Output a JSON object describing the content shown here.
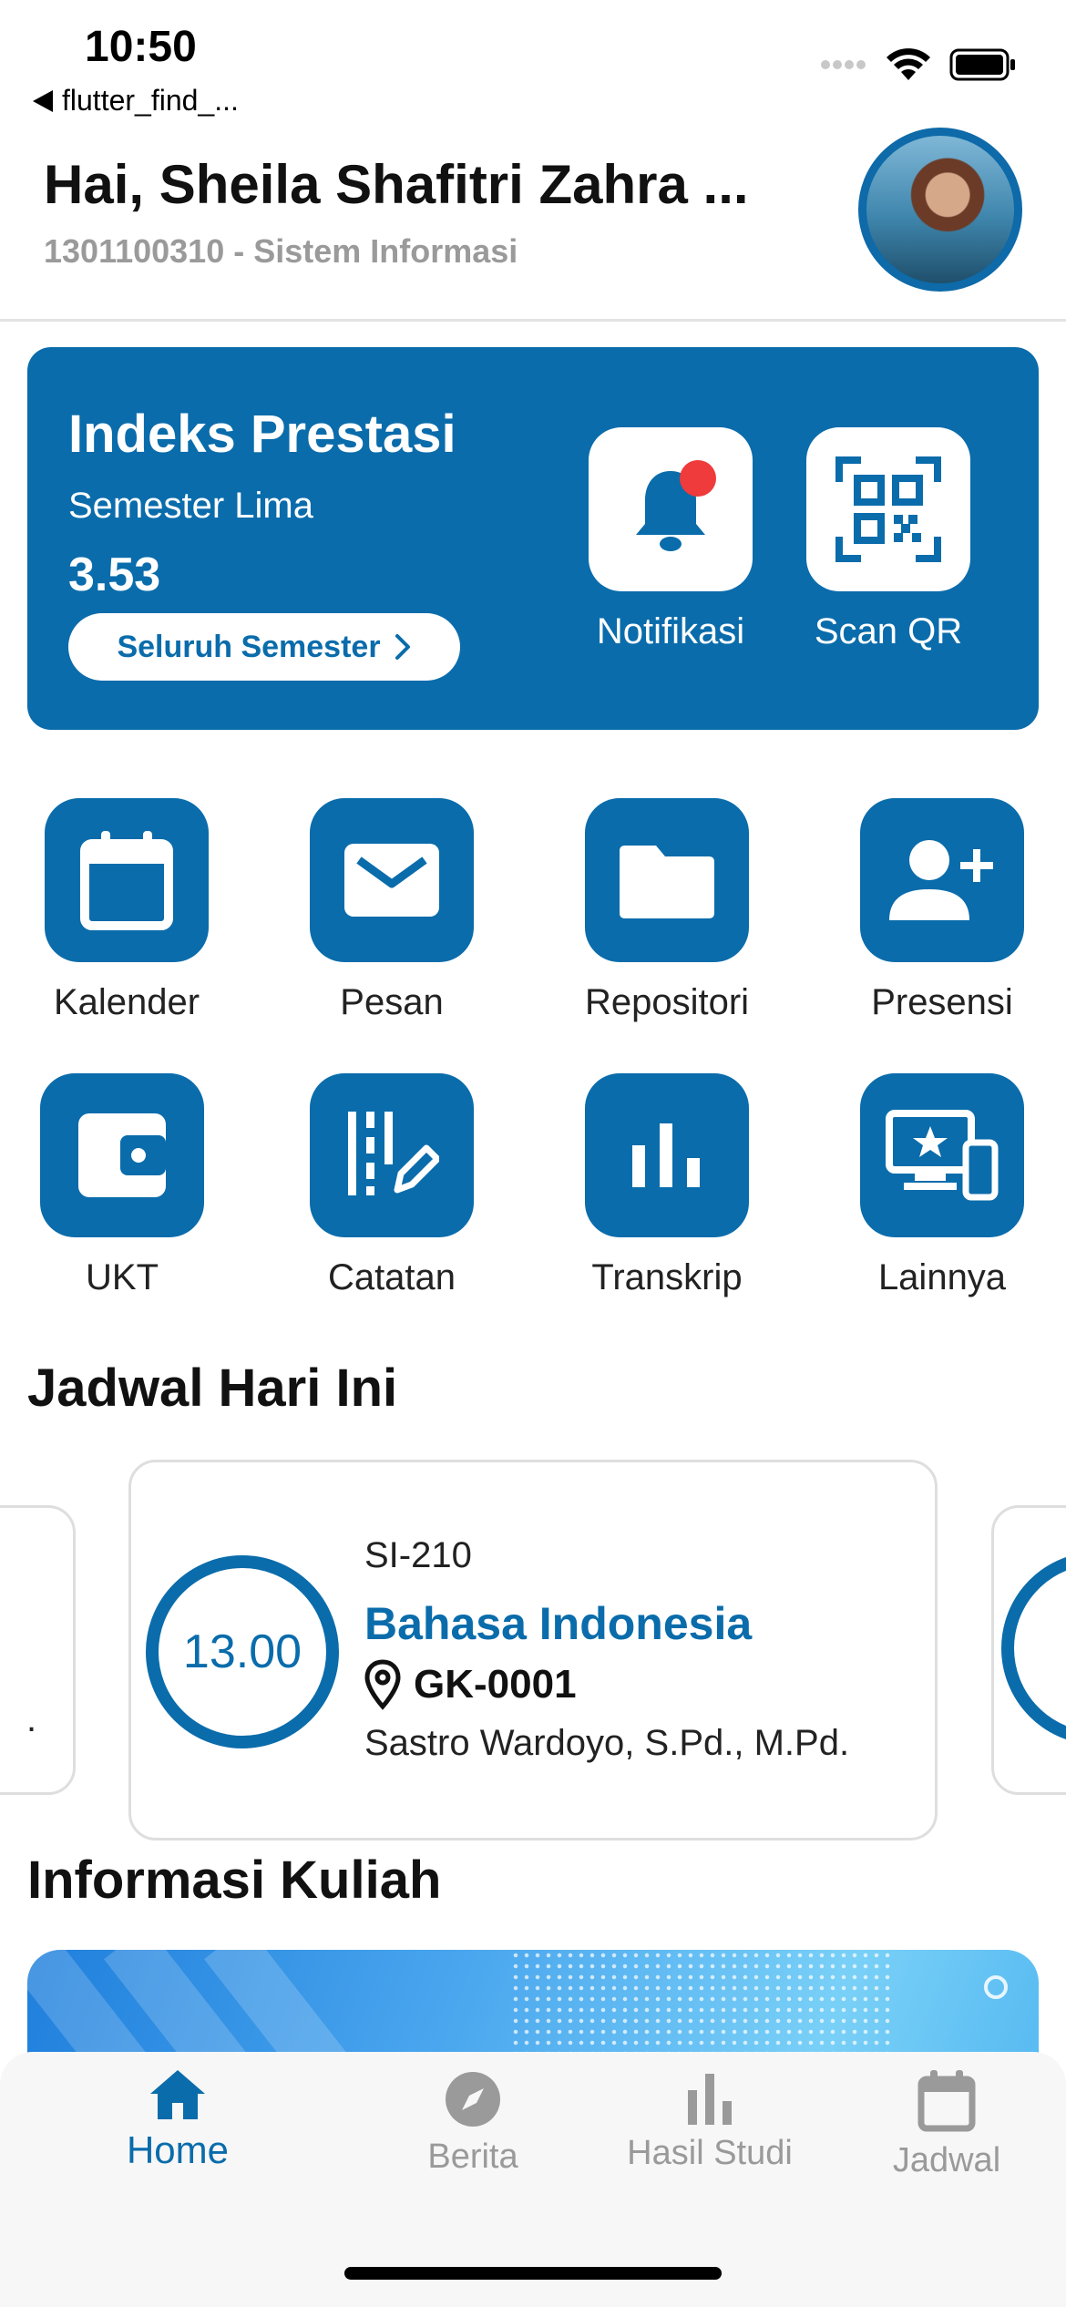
{
  "status_bar": {
    "time": "10:50",
    "back_app": "flutter_find_..."
  },
  "header": {
    "greeting": "Hai, Sheila Shafitri Zahra ...",
    "subtitle": "1301100310 - Sistem Informasi"
  },
  "ip_card": {
    "title": "Indeks Prestasi",
    "semester": "Semester Lima",
    "value": "3.53",
    "button_label": "Seluruh Semester",
    "actions": [
      {
        "label": "Notifikasi",
        "icon": "bell-icon",
        "has_badge": true
      },
      {
        "label": "Scan QR",
        "icon": "qr-code-icon"
      }
    ]
  },
  "menu": [
    {
      "label": "Kalender",
      "icon": "calendar-icon"
    },
    {
      "label": "Pesan",
      "icon": "mail-icon"
    },
    {
      "label": "Repositori",
      "icon": "folder-icon"
    },
    {
      "label": "Presensi",
      "icon": "add-person-icon"
    },
    {
      "label": "UKT",
      "icon": "wallet-icon"
    },
    {
      "label": "Catatan",
      "icon": "notes-icon"
    },
    {
      "label": "Transkrip",
      "icon": "bar-chart-icon"
    },
    {
      "label": "Lainnya",
      "icon": "devices-star-icon"
    }
  ],
  "schedule": {
    "section_title": "Jadwal Hari Ini",
    "card": {
      "time": "13.00",
      "code": "SI-210",
      "course": "Bahasa Indonesia",
      "room": "GK-0001",
      "lecturer": "Sastro Wardoyo, S.Pd., M.Pd."
    },
    "left_card_hint": "."
  },
  "info": {
    "section_title": "Informasi Kuliah"
  },
  "bottom_nav": [
    {
      "label": "Home",
      "icon": "home-icon",
      "active": true
    },
    {
      "label": "Berita",
      "icon": "compass-icon",
      "active": false
    },
    {
      "label": "Hasil Studi",
      "icon": "bar-chart-icon",
      "active": false
    },
    {
      "label": "Jadwal",
      "icon": "calendar-icon",
      "active": false
    }
  ],
  "colors": {
    "primary": "#0a6cab",
    "badge": "#ef3b3b",
    "muted": "#9a9a9a"
  }
}
